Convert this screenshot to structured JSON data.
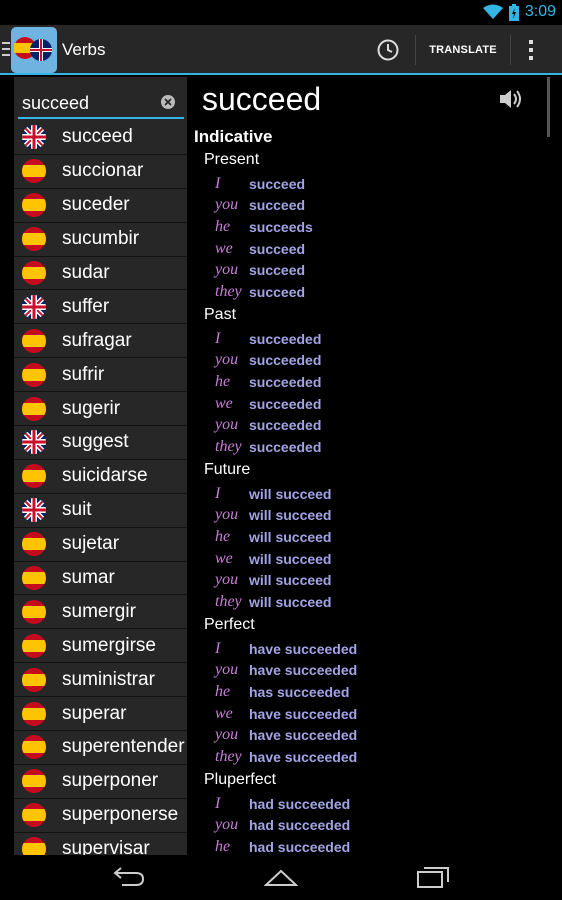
{
  "status": {
    "time": "3:09"
  },
  "app": {
    "title": "Verbs",
    "translate_label": "TRANSLATE"
  },
  "search": {
    "value": "succeed"
  },
  "words": [
    {
      "text": "succeed",
      "lang": "en"
    },
    {
      "text": "succionar",
      "lang": "es"
    },
    {
      "text": "suceder",
      "lang": "es"
    },
    {
      "text": "sucumbir",
      "lang": "es"
    },
    {
      "text": "sudar",
      "lang": "es"
    },
    {
      "text": "suffer",
      "lang": "en"
    },
    {
      "text": "sufragar",
      "lang": "es"
    },
    {
      "text": "sufrir",
      "lang": "es"
    },
    {
      "text": "sugerir",
      "lang": "es"
    },
    {
      "text": "suggest",
      "lang": "en"
    },
    {
      "text": "suicidarse",
      "lang": "es"
    },
    {
      "text": "suit",
      "lang": "en"
    },
    {
      "text": "sujetar",
      "lang": "es"
    },
    {
      "text": "sumar",
      "lang": "es"
    },
    {
      "text": "sumergir",
      "lang": "es"
    },
    {
      "text": "sumergirse",
      "lang": "es"
    },
    {
      "text": "suministrar",
      "lang": "es"
    },
    {
      "text": "superar",
      "lang": "es"
    },
    {
      "text": "superentender",
      "lang": "es"
    },
    {
      "text": "superponer",
      "lang": "es"
    },
    {
      "text": "superponerse",
      "lang": "es"
    },
    {
      "text": "supervisar",
      "lang": "es"
    }
  ],
  "verb": {
    "title": "succeed",
    "mood": "Indicative"
  },
  "tenses": [
    {
      "name": "Present",
      "lines": [
        {
          "pronoun": "I",
          "form": "succeed"
        },
        {
          "pronoun": "you",
          "form": "succeed"
        },
        {
          "pronoun": "he",
          "form": "succeeds"
        },
        {
          "pronoun": "we",
          "form": "succeed"
        },
        {
          "pronoun": "you",
          "form": "succeed"
        },
        {
          "pronoun": "they",
          "form": "succeed"
        }
      ]
    },
    {
      "name": "Past",
      "lines": [
        {
          "pronoun": "I",
          "form": "succeeded"
        },
        {
          "pronoun": "you",
          "form": "succeeded"
        },
        {
          "pronoun": "he",
          "form": "succeeded"
        },
        {
          "pronoun": "we",
          "form": "succeeded"
        },
        {
          "pronoun": "you",
          "form": "succeeded"
        },
        {
          "pronoun": "they",
          "form": "succeeded"
        }
      ]
    },
    {
      "name": "Future",
      "lines": [
        {
          "pronoun": "I",
          "form": "will succeed"
        },
        {
          "pronoun": "you",
          "form": "will succeed"
        },
        {
          "pronoun": "he",
          "form": "will succeed"
        },
        {
          "pronoun": "we",
          "form": "will succeed"
        },
        {
          "pronoun": "you",
          "form": "will succeed"
        },
        {
          "pronoun": "they",
          "form": "will succeed"
        }
      ]
    },
    {
      "name": "Perfect",
      "lines": [
        {
          "pronoun": "I",
          "form": "have succeeded"
        },
        {
          "pronoun": "you",
          "form": "have succeeded"
        },
        {
          "pronoun": "he",
          "form": "has succeeded"
        },
        {
          "pronoun": "we",
          "form": "have succeeded"
        },
        {
          "pronoun": "you",
          "form": "have succeeded"
        },
        {
          "pronoun": "they",
          "form": "have succeeded"
        }
      ]
    },
    {
      "name": "Pluperfect",
      "lines": [
        {
          "pronoun": "I",
          "form": "had succeeded"
        },
        {
          "pronoun": "you",
          "form": "had succeeded"
        },
        {
          "pronoun": "he",
          "form": "had succeeded"
        }
      ]
    }
  ],
  "colors": {
    "accent": "#33b5e5",
    "pronoun": "#c77fd8",
    "verb_form": "#a3a3e8",
    "panel": "#272727"
  },
  "icons": [
    "wifi-icon",
    "battery-icon",
    "menu-bars-icon",
    "app-flags-icon",
    "history-icon",
    "overflow-icon",
    "clear-icon",
    "speaker-icon",
    "uk-flag-icon",
    "spain-flag-icon",
    "back-icon",
    "home-icon",
    "recents-icon"
  ]
}
